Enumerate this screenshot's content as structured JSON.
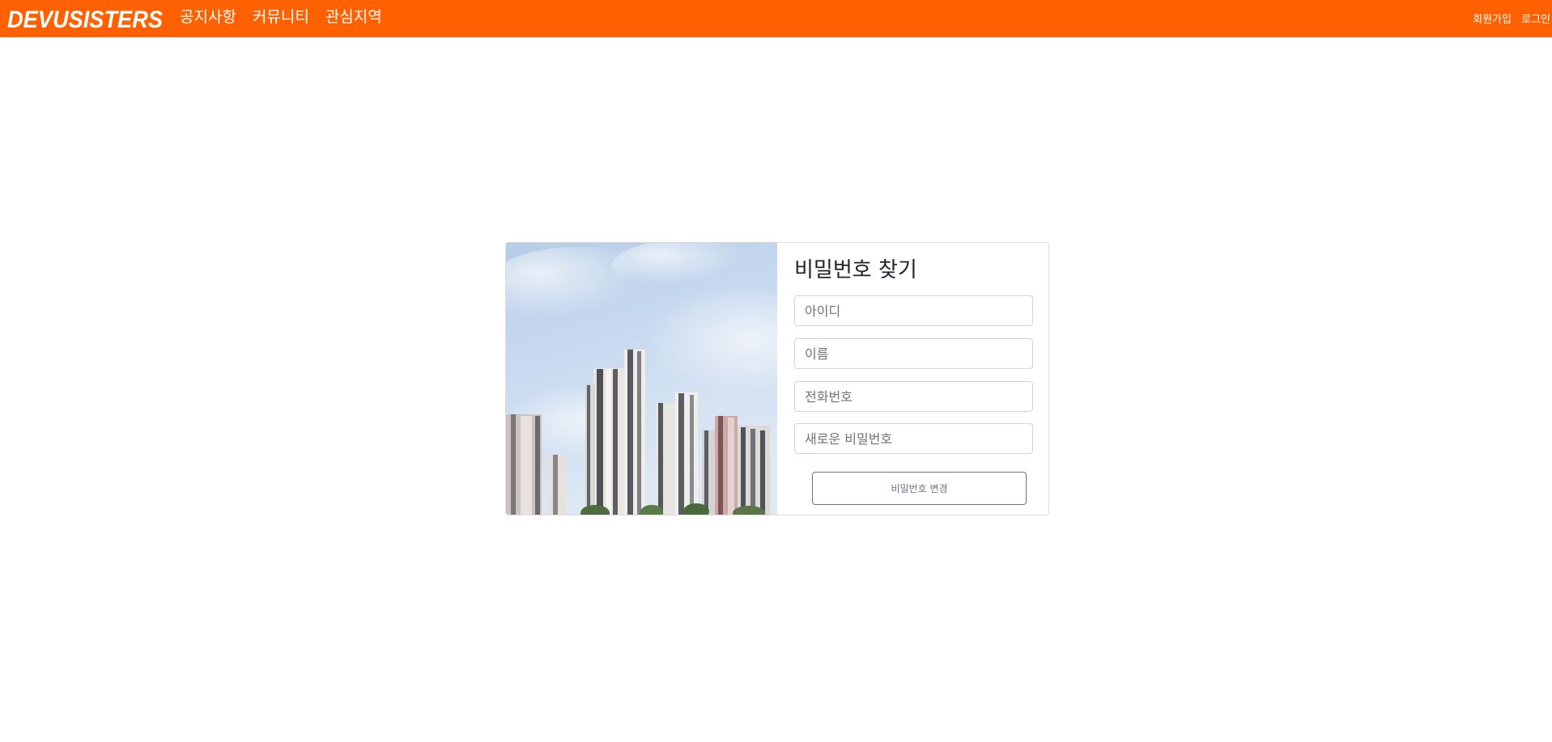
{
  "navbar": {
    "brand": "DEVUSISTERS",
    "links": [
      "공지사항",
      "커뮤니티",
      "관심지역"
    ],
    "right_links": [
      "회원가입",
      "로그인"
    ],
    "background_color": "#ff6000"
  },
  "find_password_form": {
    "title": "비밀번호 찾기",
    "fields": {
      "id_placeholder": "아이디",
      "name_placeholder": "이름",
      "phone_placeholder": "전화번호",
      "new_password_placeholder": "새로운 비밀번호"
    },
    "submit_label": "비밀번호 변경"
  }
}
